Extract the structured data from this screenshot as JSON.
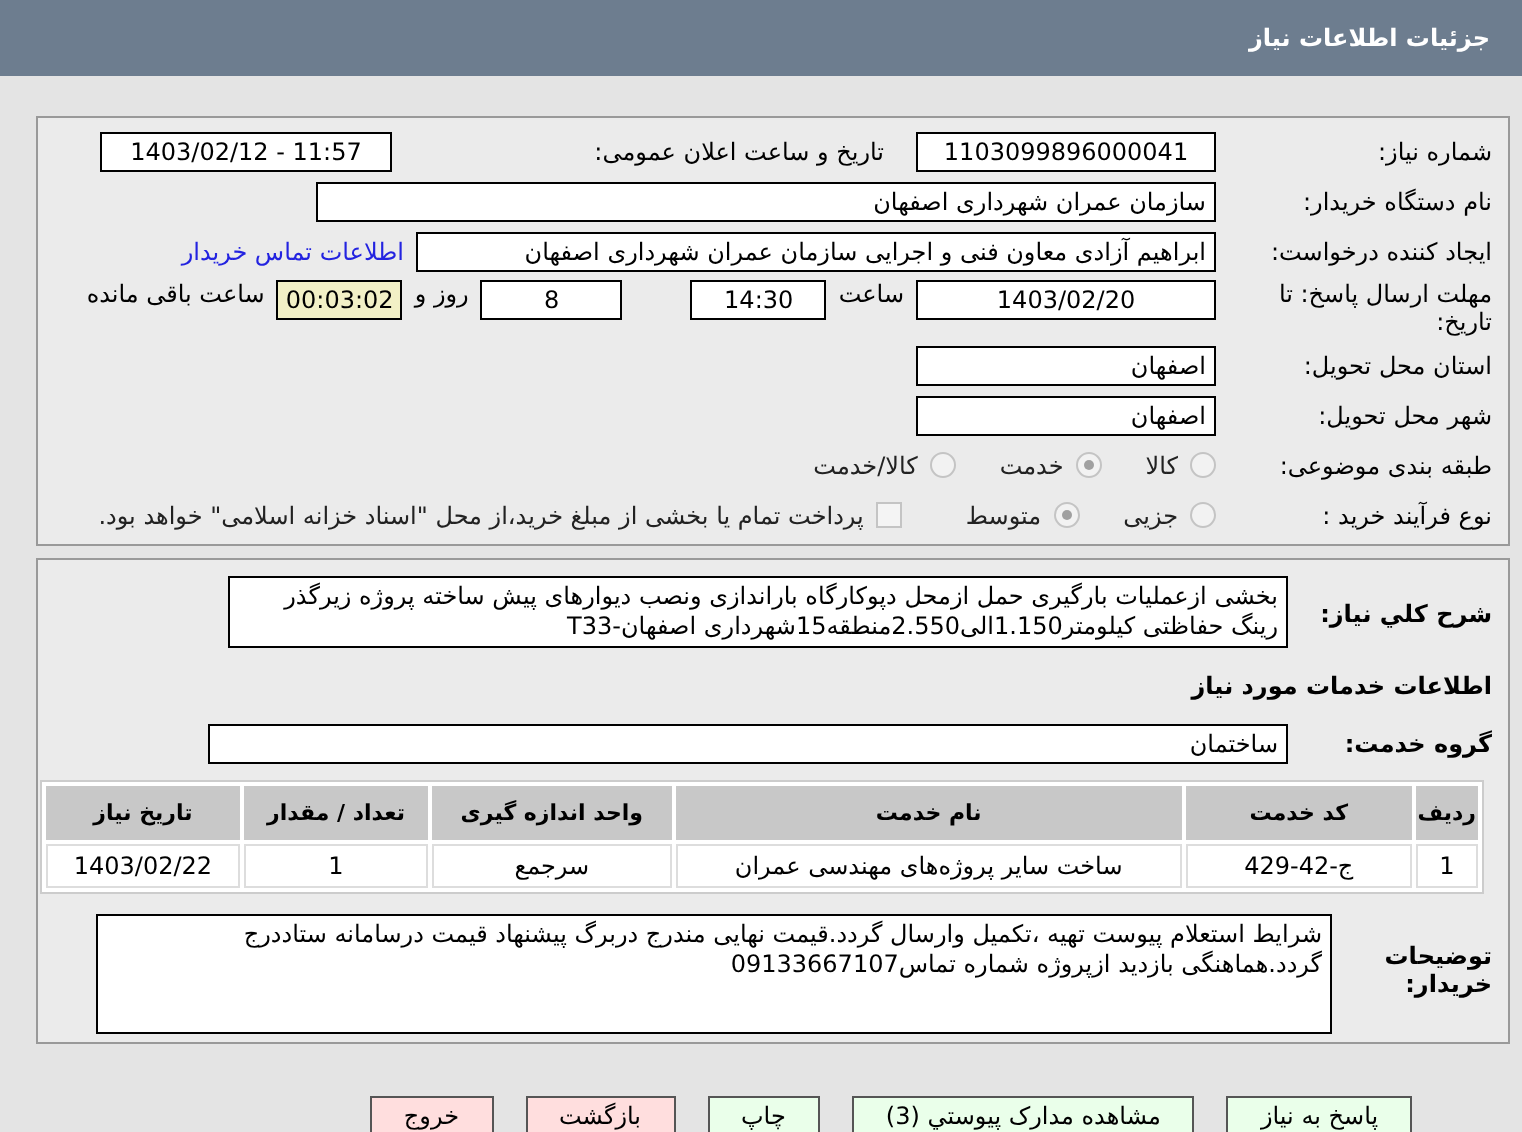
{
  "header": {
    "title": "جزئیات اطلاعات نیاز"
  },
  "need_info": {
    "need_number": {
      "label": "شماره نیاز:",
      "value": "1103099896000041"
    },
    "announce": {
      "label": "تاریخ و ساعت اعلان عمومی:",
      "value": "1403/02/12 - 11:57"
    },
    "buyer": {
      "label": "نام دستگاه خریدار:",
      "value": "سازمان عمران شهرداری اصفهان"
    },
    "creator": {
      "label": "ایجاد کننده درخواست:",
      "value": "ابراهیم آزادی معاون فنی و اجرایی سازمان عمران شهرداری اصفهان",
      "link": "اطلاعات تماس خریدار"
    },
    "deadline": {
      "label": "مهلت ارسال پاسخ: تا تاریخ:",
      "date": "1403/02/20",
      "time_label": "ساعت",
      "time": "14:30",
      "days": "8",
      "days_label": "روز و",
      "remaining": "00:03:02",
      "remaining_label": "ساعت باقی مانده"
    },
    "province": {
      "label": "استان محل تحویل:",
      "value": "اصفهان"
    },
    "city": {
      "label": "شهر محل تحویل:",
      "value": "اصفهان"
    },
    "category": {
      "label": "طبقه بندی موضوعی:",
      "options": [
        {
          "label": "کالا",
          "selected": false
        },
        {
          "label": "خدمت",
          "selected": true
        },
        {
          "label": "کالا/خدمت",
          "selected": false
        }
      ]
    },
    "process": {
      "label": "نوع فرآیند خرید :",
      "options": [
        {
          "label": "جزیی",
          "selected": false
        },
        {
          "label": "متوسط",
          "selected": true
        }
      ],
      "payment": {
        "checked": false,
        "label": "پرداخت تمام یا بخشی از مبلغ خرید،از محل \"اسناد خزانه اسلامی\" خواهد بود."
      }
    }
  },
  "details": {
    "summary_label": "شرح کلي نياز:",
    "summary": "بخشی ازعملیات بارگیری حمل ازمحل دپوکارگاه باراندازی ونصب دیوارهای پیش ساخته پروژه زیرگذر رینگ حفاظتی کیلومتر1.150الی2.550منطقه15شهرداری اصفهان-T33",
    "services_title": "اطلاعات خدمات مورد نياز",
    "group_label": "گروه خدمت:",
    "group": "ساختمان",
    "table": {
      "columns": [
        "ردیف",
        "کد خدمت",
        "نام خدمت",
        "واحد اندازه گیری",
        "تعداد / مقدار",
        "تاریخ نیاز"
      ],
      "rows": [
        [
          "1",
          "ج-42-429",
          "ساخت سایر پروژه‌های مهندسی عمران",
          "سرجمع",
          "1",
          "1403/02/22"
        ]
      ]
    },
    "notes_label": "توضیحات خریدار:",
    "notes": "شرایط استعلام پیوست تهیه ،تکمیل وارسال گردد.قیمت نهایی مندرج دربرگ پیشنهاد قیمت درسامانه ستاددرج گردد.هماهنگی بازدید ازپروژه شماره تماس09133667107"
  },
  "buttons": [
    {
      "label": "پاسخ به نیاز",
      "kind": "green"
    },
    {
      "label": "مشاهده مدارک پیوستي (3)",
      "kind": "green"
    },
    {
      "label": "چاپ",
      "kind": "green"
    },
    {
      "label": "بازگشت",
      "kind": "red"
    },
    {
      "label": "خروج",
      "kind": "red"
    }
  ]
}
